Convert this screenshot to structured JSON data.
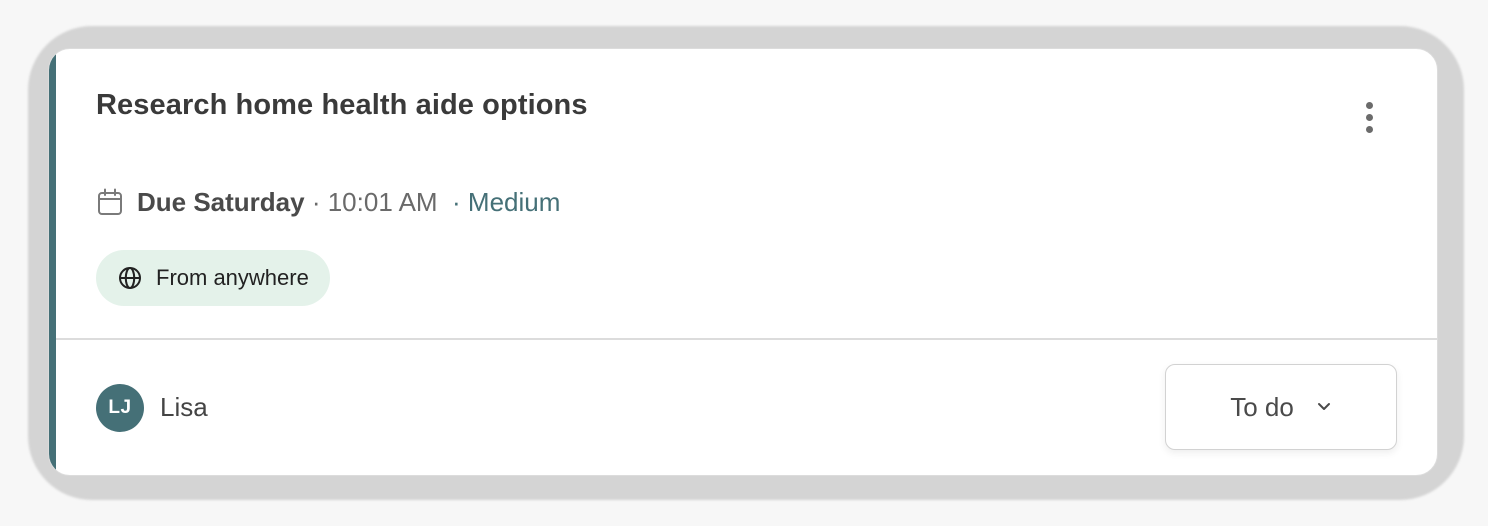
{
  "task": {
    "title": "Research home health aide options",
    "due_label": "Due Saturday",
    "separator_1": " · ",
    "due_time": "10:01 AM",
    "separator_2": "  · ",
    "priority": "Medium",
    "location_chip": "From anywhere",
    "assignee_initials": "LJ",
    "assignee_name": "Lisa",
    "status": "To do"
  },
  "icons": {
    "menu": "more-vertical-icon",
    "due": "calendar-icon",
    "location": "globe-icon",
    "status_dropdown": "chevron-down-icon"
  },
  "colors": {
    "accent": "#457077",
    "chip_background": "#e4f2ea",
    "priority_text": "#457077"
  }
}
